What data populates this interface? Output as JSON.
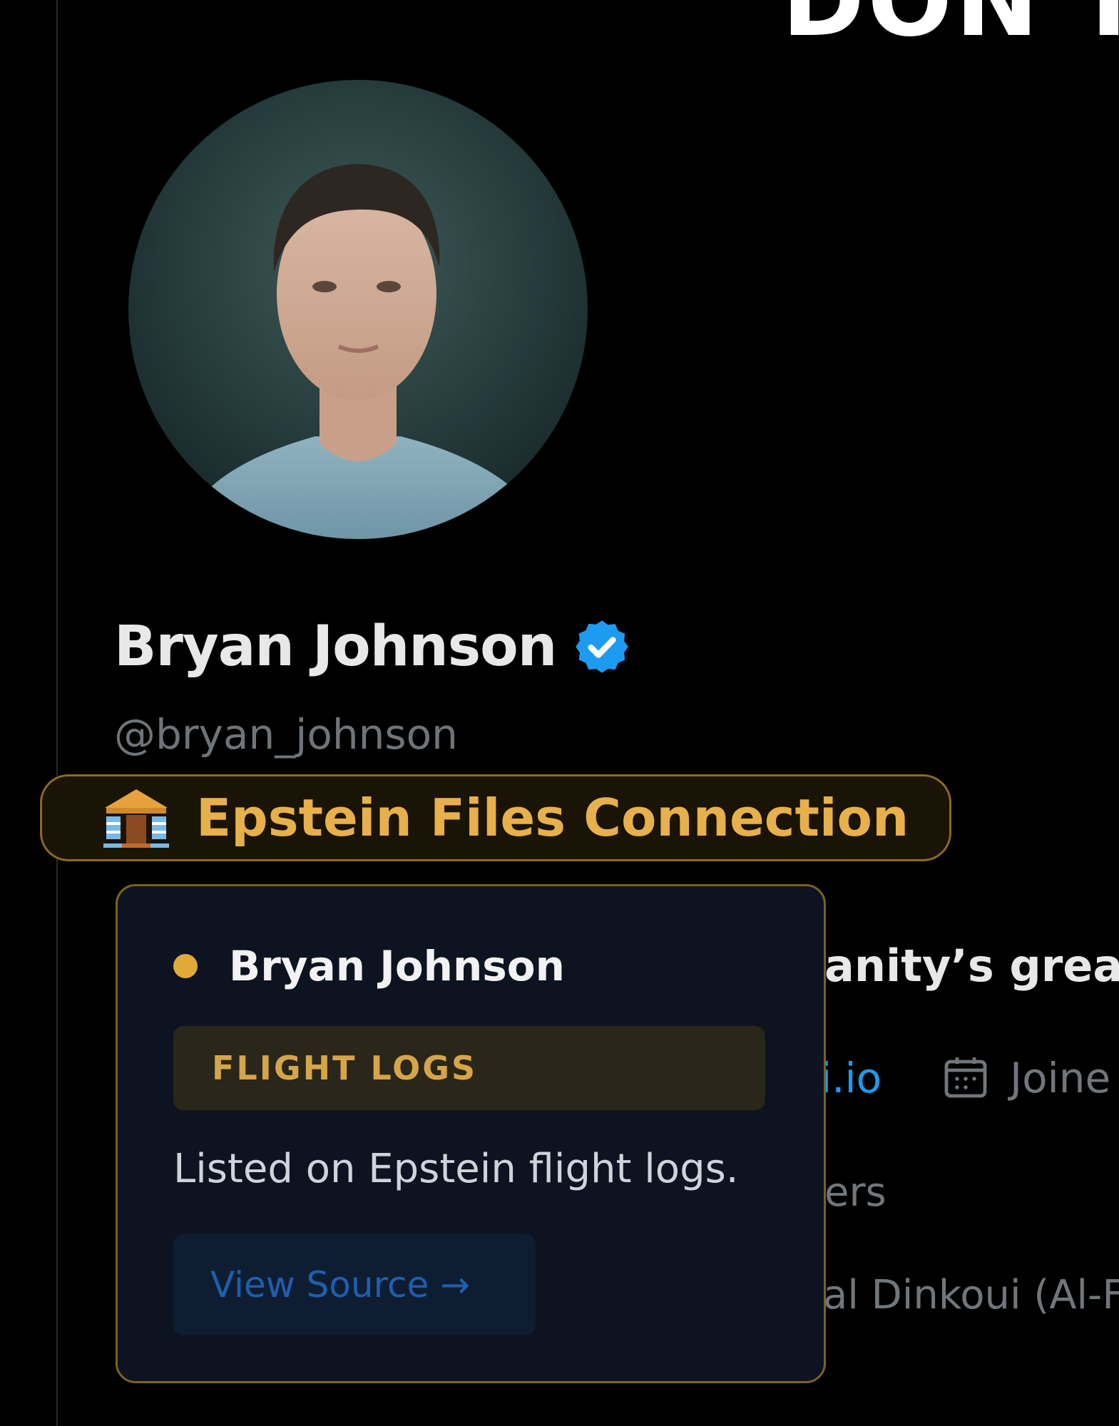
{
  "header": {
    "banner_text": "DON'T"
  },
  "profile": {
    "display_name": "Bryan Johnson",
    "handle": "@bryan_johnson",
    "verified": true,
    "verified_color": "#1d9bf0",
    "avatar_icon": "profile-photo"
  },
  "connection_badge": {
    "icon": "classical-building-icon",
    "label": "Epstein Files Connection",
    "accent_color": "#e8b04a"
  },
  "background_fragments": {
    "bio": "anity’s great",
    "link": "i.io",
    "joined_icon": "calendar-icon",
    "joined": "Joine",
    "followers": "ers",
    "followed_by": "al Dinkoui (Al-F"
  },
  "popover": {
    "person_name": "Bryan Johnson",
    "category": "FLIGHT LOGS",
    "description": "Listed on Epstein flight logs.",
    "source_button": "View Source →"
  }
}
